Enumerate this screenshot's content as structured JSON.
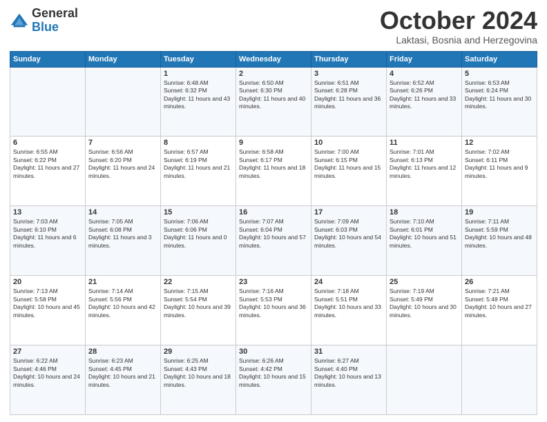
{
  "header": {
    "logo": {
      "general": "General",
      "blue": "Blue"
    },
    "title": "October 2024",
    "location": "Laktasi, Bosnia and Herzegovina"
  },
  "calendar": {
    "days_of_week": [
      "Sunday",
      "Monday",
      "Tuesday",
      "Wednesday",
      "Thursday",
      "Friday",
      "Saturday"
    ],
    "weeks": [
      [
        {
          "day": "",
          "info": ""
        },
        {
          "day": "",
          "info": ""
        },
        {
          "day": "1",
          "info": "Sunrise: 6:48 AM\nSunset: 6:32 PM\nDaylight: 11 hours and 43 minutes."
        },
        {
          "day": "2",
          "info": "Sunrise: 6:50 AM\nSunset: 6:30 PM\nDaylight: 11 hours and 40 minutes."
        },
        {
          "day": "3",
          "info": "Sunrise: 6:51 AM\nSunset: 6:28 PM\nDaylight: 11 hours and 36 minutes."
        },
        {
          "day": "4",
          "info": "Sunrise: 6:52 AM\nSunset: 6:26 PM\nDaylight: 11 hours and 33 minutes."
        },
        {
          "day": "5",
          "info": "Sunrise: 6:53 AM\nSunset: 6:24 PM\nDaylight: 11 hours and 30 minutes."
        }
      ],
      [
        {
          "day": "6",
          "info": "Sunrise: 6:55 AM\nSunset: 6:22 PM\nDaylight: 11 hours and 27 minutes."
        },
        {
          "day": "7",
          "info": "Sunrise: 6:56 AM\nSunset: 6:20 PM\nDaylight: 11 hours and 24 minutes."
        },
        {
          "day": "8",
          "info": "Sunrise: 6:57 AM\nSunset: 6:19 PM\nDaylight: 11 hours and 21 minutes."
        },
        {
          "day": "9",
          "info": "Sunrise: 6:58 AM\nSunset: 6:17 PM\nDaylight: 11 hours and 18 minutes."
        },
        {
          "day": "10",
          "info": "Sunrise: 7:00 AM\nSunset: 6:15 PM\nDaylight: 11 hours and 15 minutes."
        },
        {
          "day": "11",
          "info": "Sunrise: 7:01 AM\nSunset: 6:13 PM\nDaylight: 11 hours and 12 minutes."
        },
        {
          "day": "12",
          "info": "Sunrise: 7:02 AM\nSunset: 6:11 PM\nDaylight: 11 hours and 9 minutes."
        }
      ],
      [
        {
          "day": "13",
          "info": "Sunrise: 7:03 AM\nSunset: 6:10 PM\nDaylight: 11 hours and 6 minutes."
        },
        {
          "day": "14",
          "info": "Sunrise: 7:05 AM\nSunset: 6:08 PM\nDaylight: 11 hours and 3 minutes."
        },
        {
          "day": "15",
          "info": "Sunrise: 7:06 AM\nSunset: 6:06 PM\nDaylight: 11 hours and 0 minutes."
        },
        {
          "day": "16",
          "info": "Sunrise: 7:07 AM\nSunset: 6:04 PM\nDaylight: 10 hours and 57 minutes."
        },
        {
          "day": "17",
          "info": "Sunrise: 7:09 AM\nSunset: 6:03 PM\nDaylight: 10 hours and 54 minutes."
        },
        {
          "day": "18",
          "info": "Sunrise: 7:10 AM\nSunset: 6:01 PM\nDaylight: 10 hours and 51 minutes."
        },
        {
          "day": "19",
          "info": "Sunrise: 7:11 AM\nSunset: 5:59 PM\nDaylight: 10 hours and 48 minutes."
        }
      ],
      [
        {
          "day": "20",
          "info": "Sunrise: 7:13 AM\nSunset: 5:58 PM\nDaylight: 10 hours and 45 minutes."
        },
        {
          "day": "21",
          "info": "Sunrise: 7:14 AM\nSunset: 5:56 PM\nDaylight: 10 hours and 42 minutes."
        },
        {
          "day": "22",
          "info": "Sunrise: 7:15 AM\nSunset: 5:54 PM\nDaylight: 10 hours and 39 minutes."
        },
        {
          "day": "23",
          "info": "Sunrise: 7:16 AM\nSunset: 5:53 PM\nDaylight: 10 hours and 36 minutes."
        },
        {
          "day": "24",
          "info": "Sunrise: 7:18 AM\nSunset: 5:51 PM\nDaylight: 10 hours and 33 minutes."
        },
        {
          "day": "25",
          "info": "Sunrise: 7:19 AM\nSunset: 5:49 PM\nDaylight: 10 hours and 30 minutes."
        },
        {
          "day": "26",
          "info": "Sunrise: 7:21 AM\nSunset: 5:48 PM\nDaylight: 10 hours and 27 minutes."
        }
      ],
      [
        {
          "day": "27",
          "info": "Sunrise: 6:22 AM\nSunset: 4:46 PM\nDaylight: 10 hours and 24 minutes."
        },
        {
          "day": "28",
          "info": "Sunrise: 6:23 AM\nSunset: 4:45 PM\nDaylight: 10 hours and 21 minutes."
        },
        {
          "day": "29",
          "info": "Sunrise: 6:25 AM\nSunset: 4:43 PM\nDaylight: 10 hours and 18 minutes."
        },
        {
          "day": "30",
          "info": "Sunrise: 6:26 AM\nSunset: 4:42 PM\nDaylight: 10 hours and 15 minutes."
        },
        {
          "day": "31",
          "info": "Sunrise: 6:27 AM\nSunset: 4:40 PM\nDaylight: 10 hours and 13 minutes."
        },
        {
          "day": "",
          "info": ""
        },
        {
          "day": "",
          "info": ""
        }
      ]
    ]
  }
}
